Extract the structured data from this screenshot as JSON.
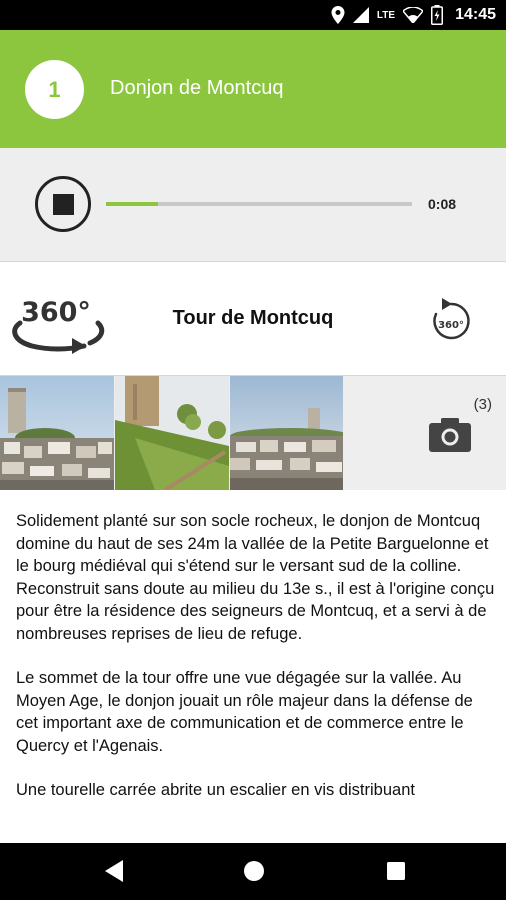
{
  "status_bar": {
    "time": "14:45",
    "network": "LTE",
    "icons": [
      "location-icon",
      "signal-icon",
      "wifi-icon",
      "battery-icon"
    ]
  },
  "header": {
    "stop_number": "1",
    "title": "Donjon de Montcuq",
    "color": "#8cc63f"
  },
  "player": {
    "elapsed": "0:08",
    "progress_fraction": 0.17,
    "state": "playing",
    "controls": [
      "stop-icon"
    ]
  },
  "tour": {
    "title": "Tour de Montcuq",
    "icon_360_label": "360°",
    "replay_label": "360°"
  },
  "gallery": {
    "photo_count": "(3)",
    "thumbnails": [
      "tower-photo-1",
      "tower-photo-2",
      "tower-photo-3"
    ]
  },
  "content": {
    "paragraphs": [
      "Solidement planté sur son socle rocheux, le donjon de Montcuq domine du haut de ses 24m la vallée de la Petite Barguelonne et le bourg médiéval qui s'étend sur le versant sud de la colline. Reconstruit sans doute au milieu du 13e s., il est à l'origine conçu pour être la résidence des seigneurs de Montcuq, et a servi à de nombreuses reprises de lieu de refuge.",
      "Le sommet de la tour offre une vue dégagée sur la vallée.  Au Moyen Age, le donjon jouait un rôle majeur dans la défense de cet important axe de communication et de commerce entre le Quercy et l'Agenais.",
      "Une tourelle carrée abrite un escalier en vis distribuant"
    ]
  },
  "nav_bar": {
    "buttons": [
      "back-icon",
      "home-icon",
      "recents-icon"
    ]
  }
}
